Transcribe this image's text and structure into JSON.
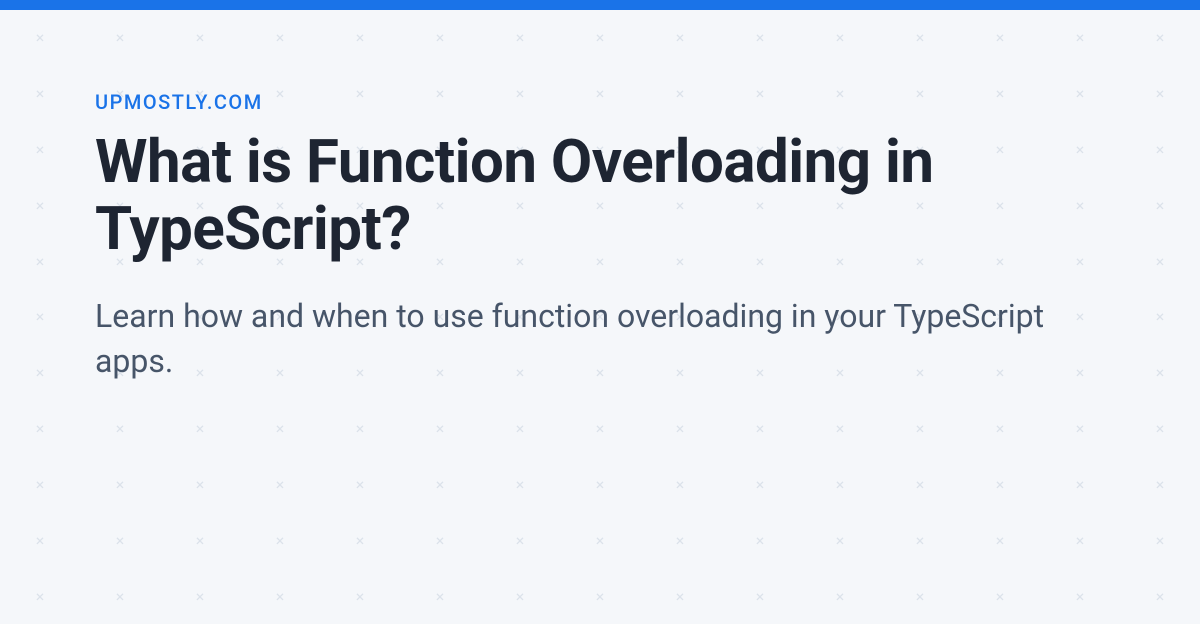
{
  "site_name": "UPMOSTLY.COM",
  "headline": "What is Function Overloading in TypeScript?",
  "description": "Learn how and when to use function overloading in your TypeScript apps."
}
